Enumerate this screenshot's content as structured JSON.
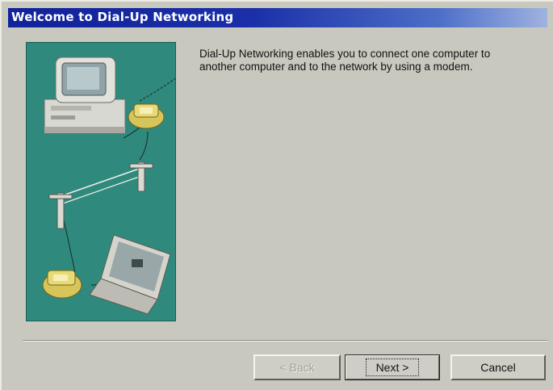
{
  "window": {
    "title": "Welcome to Dial-Up Networking"
  },
  "content": {
    "description": "Dial-Up Networking enables you to connect one computer to another computer and to the network by using a modem."
  },
  "illustration": {
    "background_color": "#2f8a7d",
    "icons": [
      "desktop-computer-icon",
      "telephone-icon",
      "telephone-pole-icon",
      "laptop-icon"
    ]
  },
  "buttons": {
    "back_label": "< Back",
    "next_label": "Next >",
    "cancel_label": "Cancel"
  },
  "colors": {
    "title_bar": "#11229a",
    "dialog_background": "#c9c8bf"
  }
}
